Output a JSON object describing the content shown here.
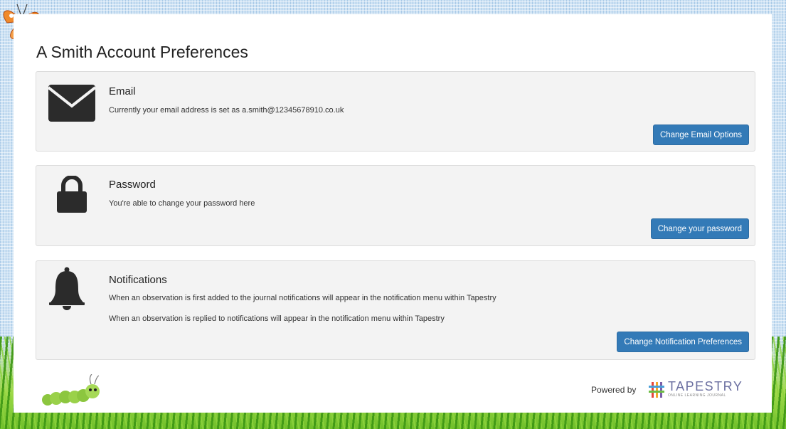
{
  "page": {
    "title": "A Smith Account Preferences"
  },
  "sections": {
    "email": {
      "title": "Email",
      "description": "Currently your email address is set as a.smith@12345678910.co.uk",
      "button_label": "Change Email Options"
    },
    "password": {
      "title": "Password",
      "description": "You're able to change your password here",
      "button_label": "Change your password"
    },
    "notifications": {
      "title": "Notifications",
      "line1": "When an observation is first added to the journal notifications will appear in the notification menu within Tapestry",
      "line2": "When an observation is replied to notifications will appear in the notification menu within Tapestry",
      "button_label": "Change Notification Preferences"
    }
  },
  "footer": {
    "powered_by": "Powered by",
    "brand": "TAPESTRY",
    "brand_tagline": "ONLINE LEARNING JOURNAL"
  },
  "colors": {
    "button_bg": "#337ab7",
    "panel_bg": "#f3f3f3",
    "icon": "#2b2b2b",
    "grass": "#8fd13f",
    "page_bg": "#cfe3f4"
  }
}
